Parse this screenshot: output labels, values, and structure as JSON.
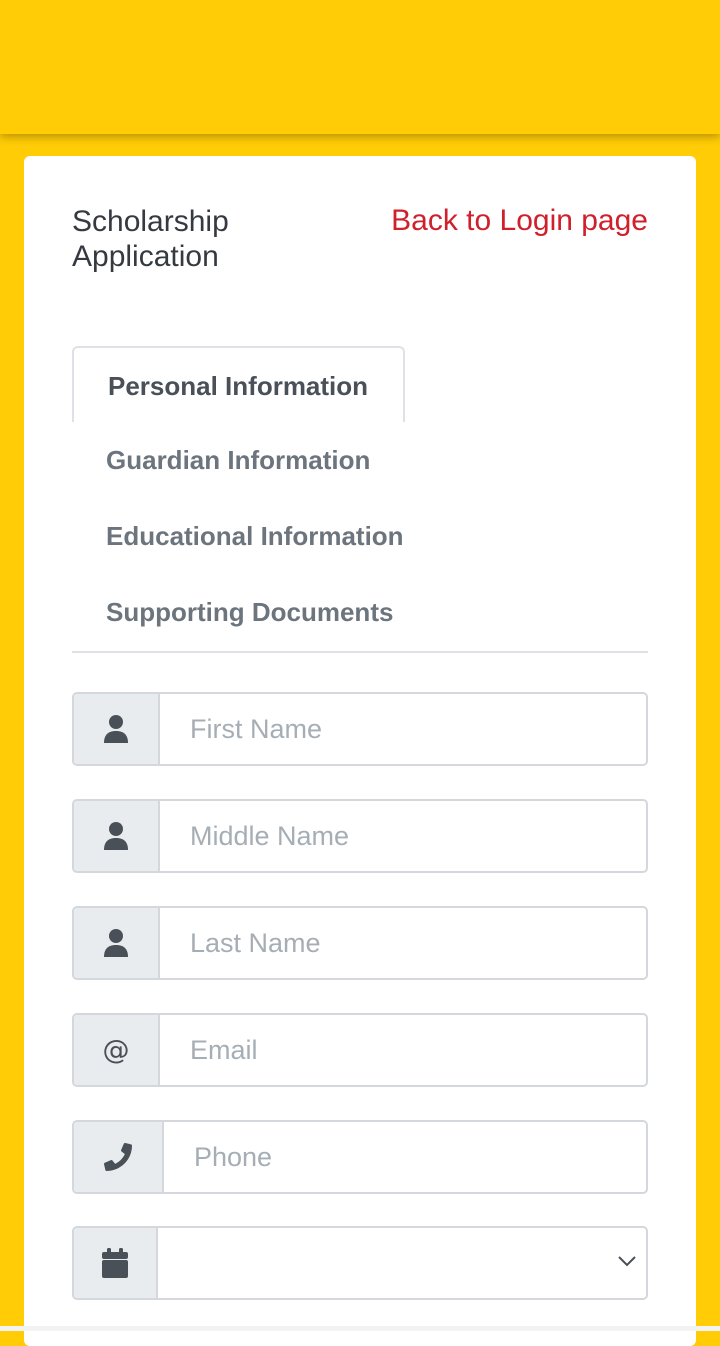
{
  "header": {
    "title": "Scholarship Application",
    "back_link": "Back to Login page"
  },
  "tabs": [
    {
      "label": "Personal Information",
      "active": true
    },
    {
      "label": "Guardian Information",
      "active": false
    },
    {
      "label": "Educational Information",
      "active": false
    },
    {
      "label": "Supporting Documents",
      "active": false
    }
  ],
  "form": {
    "first_name": {
      "placeholder": "First Name",
      "value": "",
      "icon": "user-icon"
    },
    "middle_name": {
      "placeholder": "Middle Name",
      "value": "",
      "icon": "user-icon"
    },
    "last_name": {
      "placeholder": "Last Name",
      "value": "",
      "icon": "user-icon"
    },
    "email": {
      "placeholder": "Email",
      "value": "",
      "icon_text": "@"
    },
    "phone": {
      "placeholder": "Phone",
      "value": "",
      "icon": "phone-icon"
    },
    "date_select": {
      "value": "",
      "icon": "calendar-icon"
    }
  },
  "colors": {
    "brand_yellow": "#ffcc05",
    "link_red": "#d0202b",
    "text_dark": "#343a40",
    "tab_muted": "#6c757d",
    "addon_bg": "#e9ecef"
  }
}
